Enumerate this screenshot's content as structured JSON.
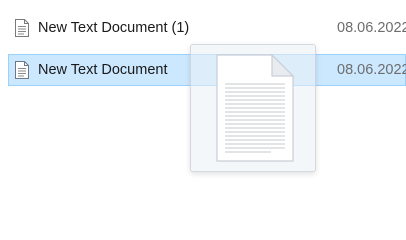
{
  "files": [
    {
      "name": "New Text Document (1)",
      "date": "08.06.2022",
      "icon": "text-file-icon",
      "selected": false
    },
    {
      "name": "New Text Document",
      "date": "08.06.2022",
      "icon": "text-file-icon",
      "selected": true
    }
  ],
  "drag_preview": {
    "icon": "text-document-icon"
  },
  "colors": {
    "selection_background": "#cce8ff",
    "selection_border": "#99d1ff",
    "name_text": "#1a1a1a",
    "date_text": "#6d6d6d"
  }
}
